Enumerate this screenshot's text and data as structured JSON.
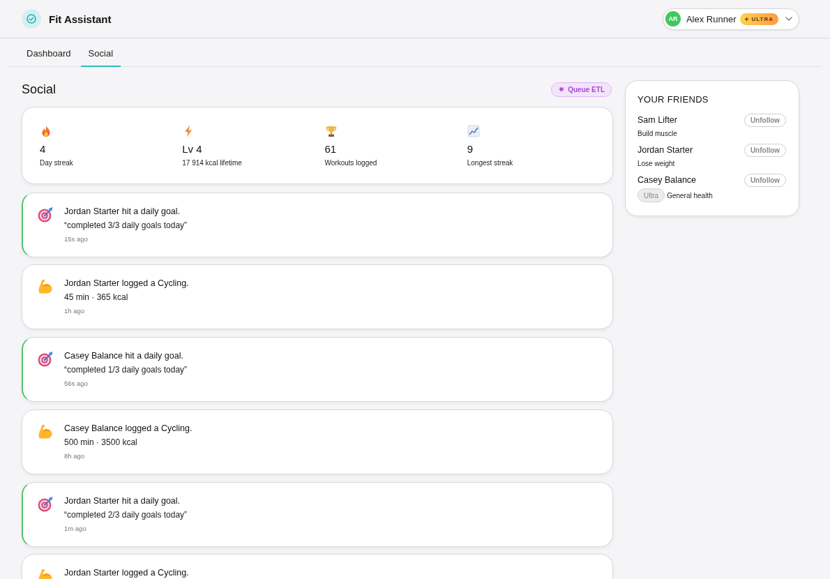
{
  "header": {
    "app_title": "Fit Assistant",
    "user": {
      "initials": "AR",
      "name": "Alex Runner",
      "badge": "ULTRA"
    }
  },
  "tabs": [
    {
      "label": "Dashboard",
      "selected": false
    },
    {
      "label": "Social",
      "selected": true
    }
  ],
  "page": {
    "title": "Social",
    "action": "Queue ETL"
  },
  "stats": [
    {
      "value": "4",
      "label": "Day streak"
    },
    {
      "value": "Lv 4",
      "label": "17 914 kcal lifetime"
    },
    {
      "value": "61",
      "label": "Workouts logged"
    },
    {
      "value": "9",
      "label": "Longest streak"
    }
  ],
  "feed": [
    {
      "kind": "goal",
      "title": "Jordan Starter hit a daily goal.",
      "detail": "“completed 3/3 daily goals today”",
      "time": "15s ago"
    },
    {
      "kind": "workout",
      "title": "Jordan Starter logged a Cycling.",
      "detail": "45 min · 365 kcal",
      "time": "1h ago"
    },
    {
      "kind": "goal",
      "title": "Casey Balance hit a daily goal.",
      "detail": "“completed 1/3 daily goals today”",
      "time": "56s ago"
    },
    {
      "kind": "workout",
      "title": "Casey Balance logged a Cycling.",
      "detail": "500 min · 3500 kcal",
      "time": "8h ago"
    },
    {
      "kind": "goal",
      "title": "Jordan Starter hit a daily goal.",
      "detail": "“completed 2/3 daily goals today”",
      "time": "1m ago"
    },
    {
      "kind": "workout",
      "title": "Jordan Starter logged a Cycling."
    }
  ],
  "friends": {
    "title": "YOUR FRIENDS",
    "items": [
      {
        "name": "Sam Lifter",
        "goal": "Build muscle",
        "button": "Unfollow"
      },
      {
        "name": "Jordan Starter",
        "goal": "Lose weight",
        "button": "Unfollow"
      },
      {
        "name": "Casey Balance",
        "badge": "Ultra",
        "goal": "General health",
        "button": "Unfollow"
      }
    ]
  }
}
